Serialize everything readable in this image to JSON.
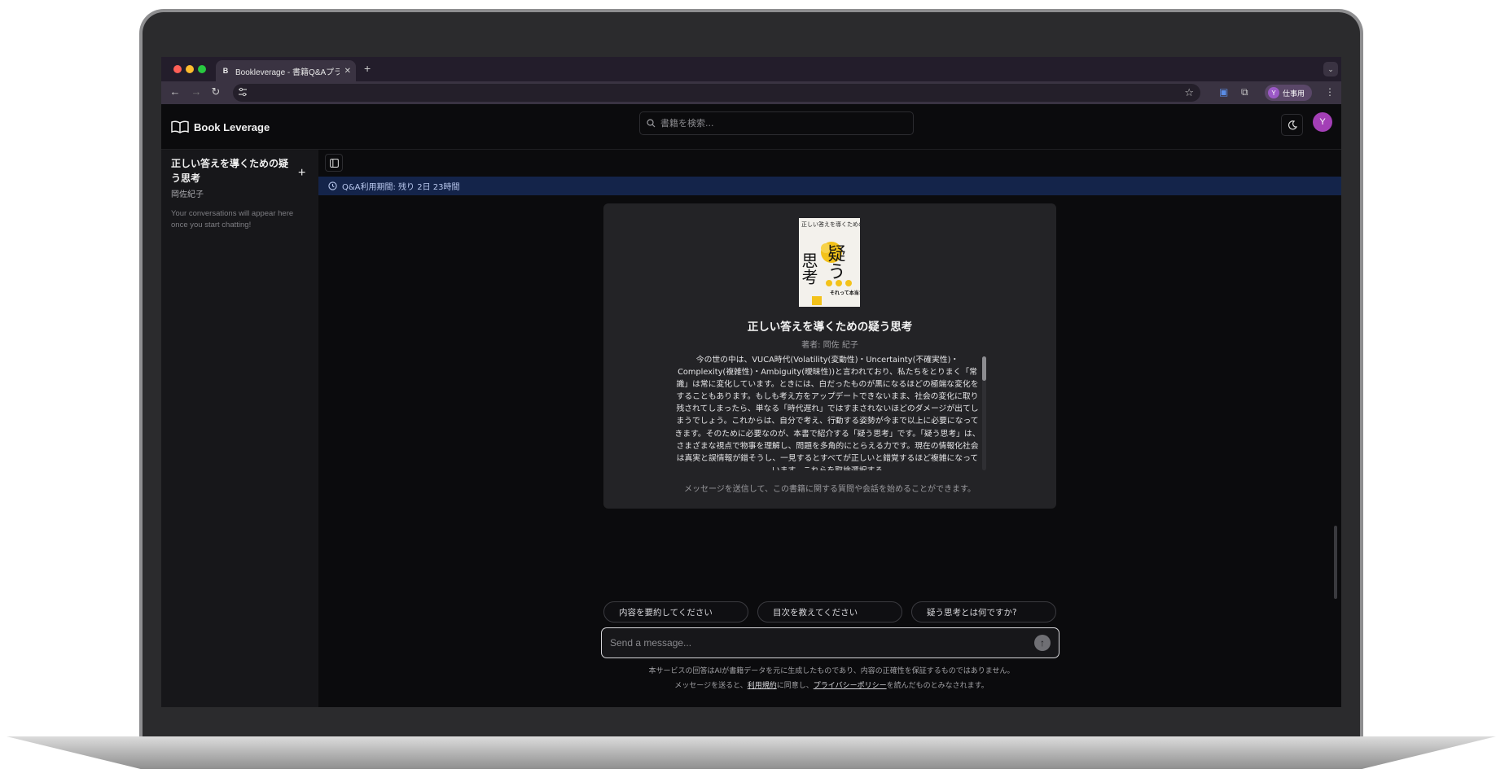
{
  "browser": {
    "tab_title": "Bookleverage - 書籍Q&Aプラット",
    "tab_favicon": "B",
    "new_tab": "+",
    "tab_close": "✕",
    "profile_initial": "Y",
    "profile_label": "仕事用"
  },
  "header": {
    "logo_text": "Book Leverage",
    "search_placeholder": "書籍を検索...",
    "avatar_initial": "Y"
  },
  "sidebar": {
    "book_title": "正しい答えを導くための疑う思考",
    "book_author": "岡佐紀子",
    "empty_message": "Your conversations will appear here once you start chatting!",
    "add_label": "+"
  },
  "notice": {
    "text": "Q&A利用期間: 残り 2日 23時間"
  },
  "book": {
    "title": "正しい答えを導くための疑う思考",
    "author": "著者: 岡佐 紀子",
    "description": "今の世の中は、VUCA時代(Volatility(変動性)・Uncertainty(不確実性)・Complexity(複雑性)・Ambiguity(曖昧性))と言われており、私たちをとりまく「常識」は常に変化しています。ときには、白だったものが黒になるほどの極端な変化をすることもあります。もしも考え方をアップデートできないまま、社会の変化に取り残されてしまったら、単なる「時代遅れ」ではすまされないほどのダメージが出てしまうでしょう。これからは、自分で考え、行動する姿勢が今まで以上に必要になってきます。そのために必要なのが、本書で紹介する「疑う思考」です。「疑う思考」は、さまざまな視点で物事を理解し、問題を多角的にとらえる力です。現在の情報化社会は真実と誤情報が錯そうし、一見するとすべてが正しいと錯覚するほど複雑になっています。これらを取捨選択する",
    "hint": "メッセージを送信して、この書籍に関する質問や会話を始めることができます。",
    "cover_title_small": "正しい答えを導くための",
    "cover_title_big_1": "疑う",
    "cover_title_big_2": "思考",
    "cover_tagline": "それって本当?"
  },
  "suggestions": [
    "内容を要約してください",
    "目次を教えてください",
    "疑う思考とは何ですか?"
  ],
  "composer": {
    "placeholder": "Send a message...",
    "send_icon": "↑"
  },
  "disclaimer": {
    "line1": "本サービスの回答はAIが書籍データを元に生成したものであり、内容の正確性を保証するものではありません。",
    "line2_prefix": "メッセージを送ると、",
    "terms": "利用規約",
    "line2_mid": "に同意し、",
    "privacy": "プライバシーポリシー",
    "line2_suffix": "を読んだものとみなされます。"
  }
}
